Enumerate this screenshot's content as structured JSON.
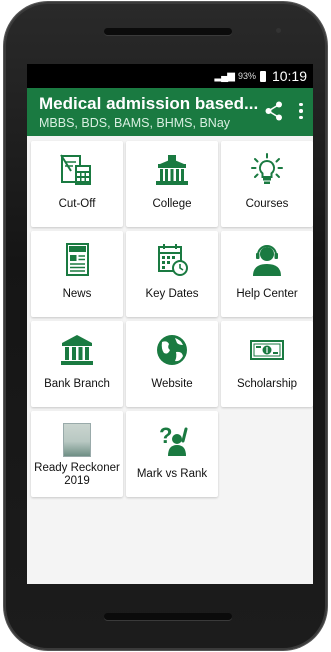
{
  "statusbar": {
    "battery_pct": "93%",
    "time": "10:19",
    "signal_icon": "signal-icon",
    "battery_icon": "battery-icon"
  },
  "appbar": {
    "title": "Medical admission based...",
    "subtitle": "MBBS, BDS, BAMS, BHMS, BNay",
    "share_icon": "share-icon",
    "more_icon": "more-vert-icon",
    "color": "#1a7a41"
  },
  "tiles": [
    {
      "label": "Cut-Off",
      "icon": "cutoff-calculator-icon"
    },
    {
      "label": "College",
      "icon": "college-building-icon"
    },
    {
      "label": "Courses",
      "icon": "lightbulb-icon"
    },
    {
      "label": "News",
      "icon": "newspaper-icon"
    },
    {
      "label": "Key Dates",
      "icon": "calendar-clock-icon"
    },
    {
      "label": "Help Center",
      "icon": "headset-support-icon"
    },
    {
      "label": "Bank Branch",
      "icon": "bank-icon"
    },
    {
      "label": "Website",
      "icon": "globe-icon"
    },
    {
      "label": "Scholarship",
      "icon": "money-note-icon"
    },
    {
      "label": "Ready Reckoner\n2019",
      "icon": "ready-reckoner-cover-image"
    },
    {
      "label": "Mark vs Rank",
      "icon": "question-person-icon"
    }
  ],
  "theme": {
    "accent": "#1a7a41",
    "background": "#f4f4f4"
  }
}
